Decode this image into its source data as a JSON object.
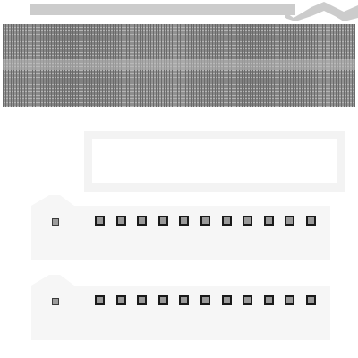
{
  "colors": {
    "page_background": "#ffffff",
    "rail_gray": "#cccccc",
    "texture_base": "#8f8f8f",
    "texture_dark": "#6a6a6a",
    "texture_light": "#b4b4b4",
    "stripe": "#bdbdbd",
    "frame": "#f3f3f3",
    "card": "#f6f6f6",
    "slot_fill": "#999999",
    "pin_fill": "#9c9c9c"
  },
  "cards": [
    {
      "slots": 11
    },
    {
      "slots": 11
    }
  ]
}
